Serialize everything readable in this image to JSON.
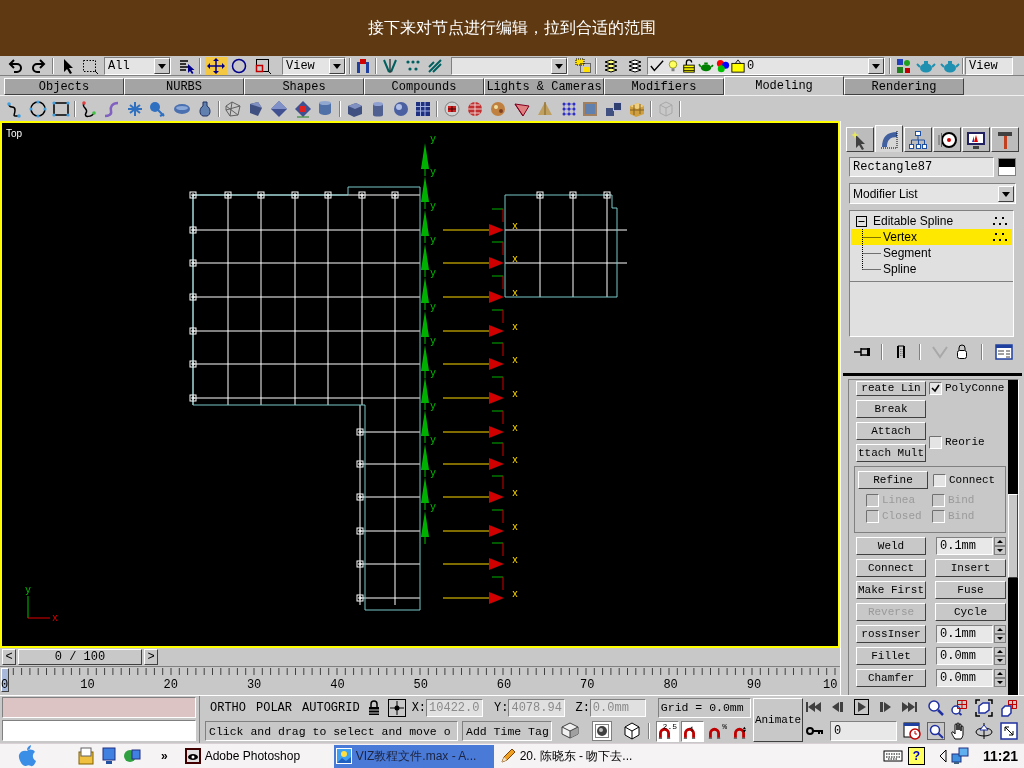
{
  "banner": {
    "text": "接下来对节点进行编辑，拉到合适的范围"
  },
  "toolbar": {
    "tools": [
      {
        "selected": false
      },
      {
        "selected": true
      },
      {
        "selected": false
      },
      {
        "selected": false
      }
    ],
    "selection_filter": "All",
    "coordinate_system": "View",
    "layer": "0",
    "render_type": "View"
  },
  "tabs": [
    {
      "label": "Objects",
      "selected": false
    },
    {
      "label": "NURBS",
      "selected": false
    },
    {
      "label": "Shapes",
      "selected": false
    },
    {
      "label": "Compounds",
      "selected": false
    },
    {
      "label": "Lights & Cameras",
      "selected": false
    },
    {
      "label": "Modifiers",
      "selected": false
    },
    {
      "label": "Modeling",
      "selected": true
    },
    {
      "label": "Rendering",
      "selected": false
    }
  ],
  "viewport": {
    "label": "Top",
    "gizmos": [
      {
        "x_label": "x",
        "y_label": "y"
      },
      {
        "x_label": "x",
        "y_label": "y"
      },
      {
        "x_label": "x",
        "y_label": "y"
      },
      {
        "x_label": "x",
        "y_label": "y"
      },
      {
        "x_label": "x",
        "y_label": "y"
      },
      {
        "x_label": "x",
        "y_label": "y"
      },
      {
        "x_label": "x",
        "y_label": "y"
      },
      {
        "x_label": "x",
        "y_label": "y"
      },
      {
        "x_label": "x",
        "y_label": "y"
      },
      {
        "x_label": "x",
        "y_label": "y"
      },
      {
        "x_label": "x",
        "y_label": "y"
      },
      {
        "x_label": "x",
        "y_label": "y"
      }
    ],
    "axis_tripod": {
      "x_label": "x",
      "y_label": "y"
    }
  },
  "command_panel": {
    "tabs": [
      {
        "selected": false
      },
      {
        "selected": true
      },
      {
        "selected": false
      },
      {
        "selected": false
      },
      {
        "selected": false
      },
      {
        "selected": false
      }
    ],
    "object_name": "Rectangle87",
    "modifier_list": "Modifier List",
    "stack": [
      {
        "label": "Editable Spline",
        "selected": false,
        "expanded": true,
        "children": [
          {
            "label": "Vertex",
            "selected": true
          },
          {
            "label": "Segment",
            "selected": false
          },
          {
            "label": "Spline",
            "selected": false
          }
        ]
      }
    ],
    "rollout": [
      {
        "kind": "button_check",
        "button": {
          "label": "reate Lin",
          "disabled": false
        },
        "check": {
          "label": "PolyConne",
          "checked": true,
          "disabled": false
        }
      },
      {
        "kind": "button",
        "button": {
          "label": "Break",
          "disabled": false
        }
      },
      {
        "kind": "buttons_check",
        "buttons": [
          {
            "label": "Attach",
            "disabled": false
          },
          {
            "label": "ttach Mult",
            "disabled": false
          }
        ],
        "check": {
          "label": "Reorie",
          "checked": false,
          "disabled": false
        }
      },
      {
        "kind": "group",
        "button": {
          "label": "Refine",
          "disabled": false
        },
        "check": {
          "label": "Connect",
          "checked": false,
          "disabled": false
        },
        "options": [
          {
            "label": "Linea",
            "checked": false,
            "disabled": true
          },
          {
            "label": "Bind",
            "checked": false,
            "disabled": true
          },
          {
            "label": "Closed",
            "checked": false,
            "disabled": true
          },
          {
            "label": "Bind",
            "checked": false,
            "disabled": true
          }
        ]
      },
      {
        "kind": "button_spinner",
        "button": {
          "label": "Weld",
          "disabled": false
        },
        "value": "0.1mm"
      },
      {
        "kind": "button_pair",
        "buttons": [
          {
            "label": "Connect",
            "disabled": false
          },
          {
            "label": "Insert",
            "disabled": false
          }
        ]
      },
      {
        "kind": "button_pair",
        "buttons": [
          {
            "label": "Make First",
            "disabled": false
          },
          {
            "label": "Fuse",
            "disabled": false
          }
        ]
      },
      {
        "kind": "button_pair",
        "buttons": [
          {
            "label": "Reverse",
            "disabled": true
          },
          {
            "label": "Cycle",
            "disabled": false
          }
        ]
      },
      {
        "kind": "button_spinner",
        "button": {
          "label": "rossInser",
          "disabled": false
        },
        "value": "0.1mm"
      },
      {
        "kind": "button_spinner",
        "button": {
          "label": "Fillet",
          "disabled": false
        },
        "value": "0.0mm"
      },
      {
        "kind": "button_spinner",
        "button": {
          "label": "Chamfer",
          "disabled": false
        },
        "value": "0.0mm"
      }
    ]
  },
  "time_slider": {
    "prev": "<",
    "position": "0 / 100",
    "next": ">",
    "level": 0
  },
  "track_bar": {
    "labels": [
      "0",
      "10",
      "20",
      "30",
      "40",
      "50",
      "60",
      "70",
      "80",
      "90",
      "10"
    ]
  },
  "status_bar": {
    "snap_modes": [
      "ORTHO",
      "POLAR",
      "AUTOGRID"
    ],
    "x_label": "X:",
    "x_value": "10422.0",
    "y_label": "Y:",
    "y_value": "4078.94",
    "z_label": "Z:",
    "z_value": "0.0mm",
    "grid": "Grid = 0.0mm",
    "prompt": "Click and drag to select and move o",
    "time_tag": "Add Time Tag",
    "view_toggles": [
      {
        "on": false
      },
      {
        "on": true
      },
      {
        "on": false
      }
    ],
    "snaps": [
      {
        "kind": "magnet",
        "label": "2.5",
        "on": true
      },
      {
        "kind": "angle",
        "on": true
      },
      {
        "kind": "percent",
        "label": "%",
        "on": false
      },
      {
        "kind": "spinner",
        "on": false
      }
    ],
    "animate": "Animate",
    "current_frame": "0"
  },
  "taskbar": {
    "more": "»",
    "tasks": [
      {
        "kind": "photoshop",
        "label": "Adobe Photoshop",
        "selected": false
      },
      {
        "kind": "picture",
        "label": "VIZ教程文件.max - A...",
        "selected": true
      },
      {
        "kind": "pencil",
        "label": "20. 陈晓东 - 吻下去...",
        "selected": false
      }
    ],
    "help": "?",
    "clock": "11:21"
  }
}
